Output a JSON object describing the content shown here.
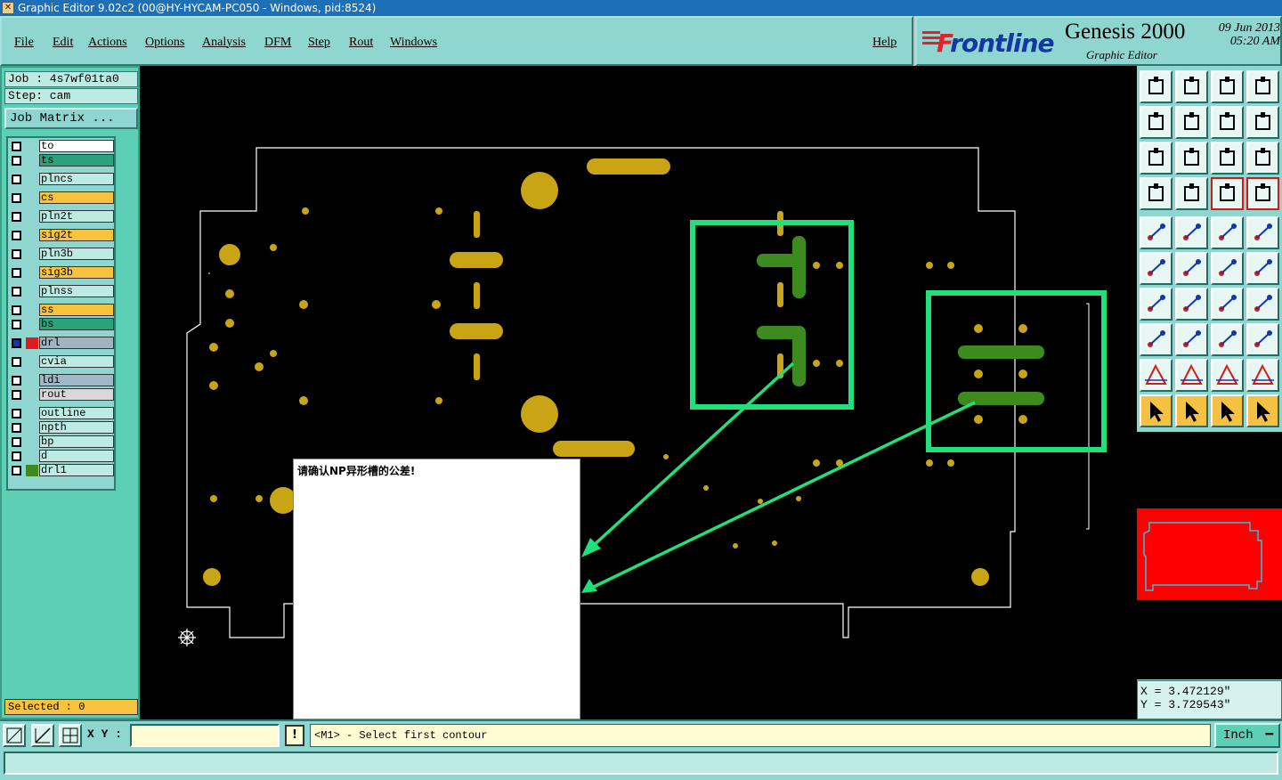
{
  "window": {
    "title": "Graphic Editor 9.02c2 (00@HY-HYCAM-PC050 - Windows, pid:8524)"
  },
  "menu": {
    "file": "File",
    "edit": "Edit",
    "actions": "Actions",
    "options": "Options",
    "analysis": "Analysis",
    "dfm": "DFM",
    "step": "Step",
    "rout": "Rout",
    "windows": "Windows",
    "help": "Help"
  },
  "brand": {
    "logo_prefix": "F",
    "logo_rest": "rontline",
    "product": "Genesis 2000",
    "subtitle": "Graphic Editor",
    "date": "09 Jun 2013",
    "time": "05:20 AM"
  },
  "job": {
    "job_label": "Job : 4s7wf01ta0",
    "step_label": "Step: cam",
    "matrix_button": "Job Matrix ..."
  },
  "layers": [
    {
      "name": "to",
      "color": "#ffffff"
    },
    {
      "name": "ts",
      "color": "#2aa37d"
    },
    {
      "name": "plncs",
      "color": "#bdeae3"
    },
    {
      "name": "cs",
      "color": "#f7c33f"
    },
    {
      "name": "pln2t",
      "color": "#bdeae3"
    },
    {
      "name": "sig2t",
      "color": "#f7c33f"
    },
    {
      "name": "pln3b",
      "color": "#bdeae3"
    },
    {
      "name": "sig3b",
      "color": "#f7c33f"
    },
    {
      "name": "plnss",
      "color": "#bdeae3"
    },
    {
      "name": "ss",
      "color": "#f7c33f"
    },
    {
      "name": "bs",
      "color": "#2aa37d"
    },
    {
      "name": "drl",
      "color": "#9fb3c0"
    },
    {
      "name": "cvia",
      "color": "#bdeae3"
    },
    {
      "name": "ldi",
      "color": "#a0b8c8"
    },
    {
      "name": "rout",
      "color": "#d8d8d8"
    },
    {
      "name": "outline",
      "color": "#bdeae3"
    },
    {
      "name": "npth",
      "color": "#bdeae3"
    },
    {
      "name": "bp",
      "color": "#bdeae3"
    },
    {
      "name": "d",
      "color": "#bdeae3"
    },
    {
      "name": "drl1",
      "color": "#bdeae3"
    }
  ],
  "status": {
    "selected": "Selected : 0"
  },
  "canvas": {
    "message": "请确认NP异形槽的公差!"
  },
  "coords": {
    "x": "X = 3.472129\"",
    "y": "Y = 3.729543\""
  },
  "bottom": {
    "xy_label": "X Y :",
    "xy_value": "",
    "exclamation": "!",
    "prompt": "<M1> - Select first contour",
    "unit": "Inch"
  },
  "colors": {
    "accent": "#8ed6cf",
    "pad": "#c9a414",
    "trace": "#3d8a1e",
    "highlight": "#1fe07a",
    "board_outline": "#ffffff"
  }
}
